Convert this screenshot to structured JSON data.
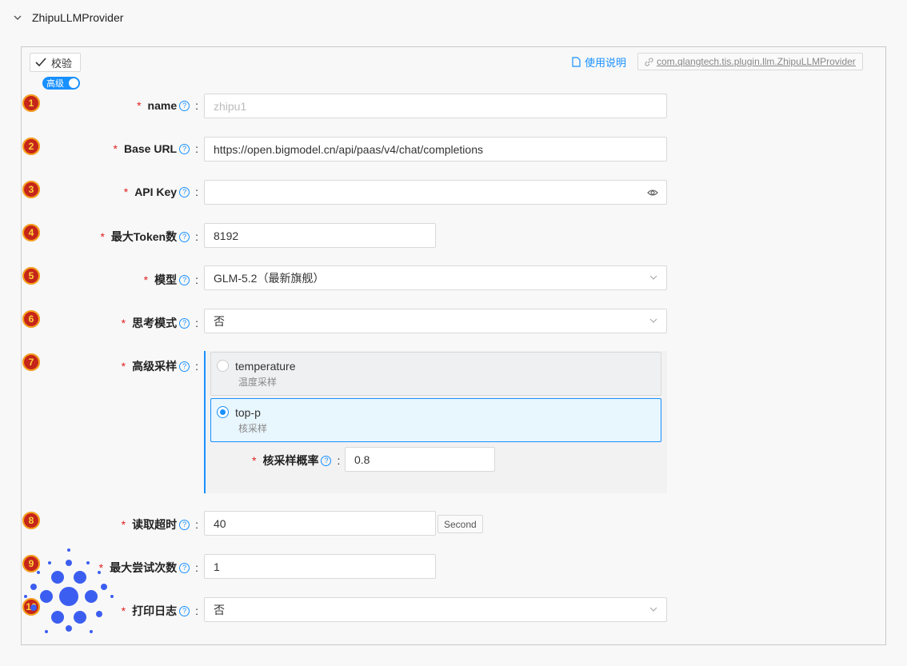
{
  "panel": {
    "title": "ZhipuLLMProvider"
  },
  "toolbar": {
    "check_label": "校验",
    "advanced_label": "高级",
    "docs_label": "使用说明",
    "package_label": "com.qlangtech.tis.plugin.llm.ZhipuLLMProvider"
  },
  "fields": {
    "name": {
      "badge": "1",
      "label": "name",
      "placeholder": "zhipu1"
    },
    "base_url": {
      "badge": "2",
      "label": "Base URL",
      "value": "https://open.bigmodel.cn/api/paas/v4/chat/completions"
    },
    "api_key": {
      "badge": "3",
      "label": "API Key",
      "value": ""
    },
    "max_tokens": {
      "badge": "4",
      "label": "最大Token数",
      "value": "8192"
    },
    "model": {
      "badge": "5",
      "label": "模型",
      "value": "GLM-5.2（最新旗舰）"
    },
    "thinking": {
      "badge": "6",
      "label": "思考模式",
      "value": "否"
    },
    "sampling": {
      "badge": "7",
      "label": "高级采样",
      "options": [
        {
          "title": "temperature",
          "sub": "温度采样",
          "selected": false
        },
        {
          "title": "top-p",
          "sub": "核采样",
          "selected": true
        }
      ],
      "top_p_label": "核采样概率",
      "top_p_value": "0.8"
    },
    "read_timeout": {
      "badge": "8",
      "label": "读取超时",
      "value": "40",
      "unit": "Second"
    },
    "max_retries": {
      "badge": "9",
      "label": "最大尝试次数",
      "value": "1"
    },
    "print_log": {
      "badge": "10",
      "label": "打印日志",
      "value": "否"
    }
  },
  "colors": {
    "accent": "#1890ff",
    "required": "#e02020",
    "badge_bg": "#c5251a",
    "badge_fg": "#fdd23a",
    "logo": "#3c5ef0"
  }
}
